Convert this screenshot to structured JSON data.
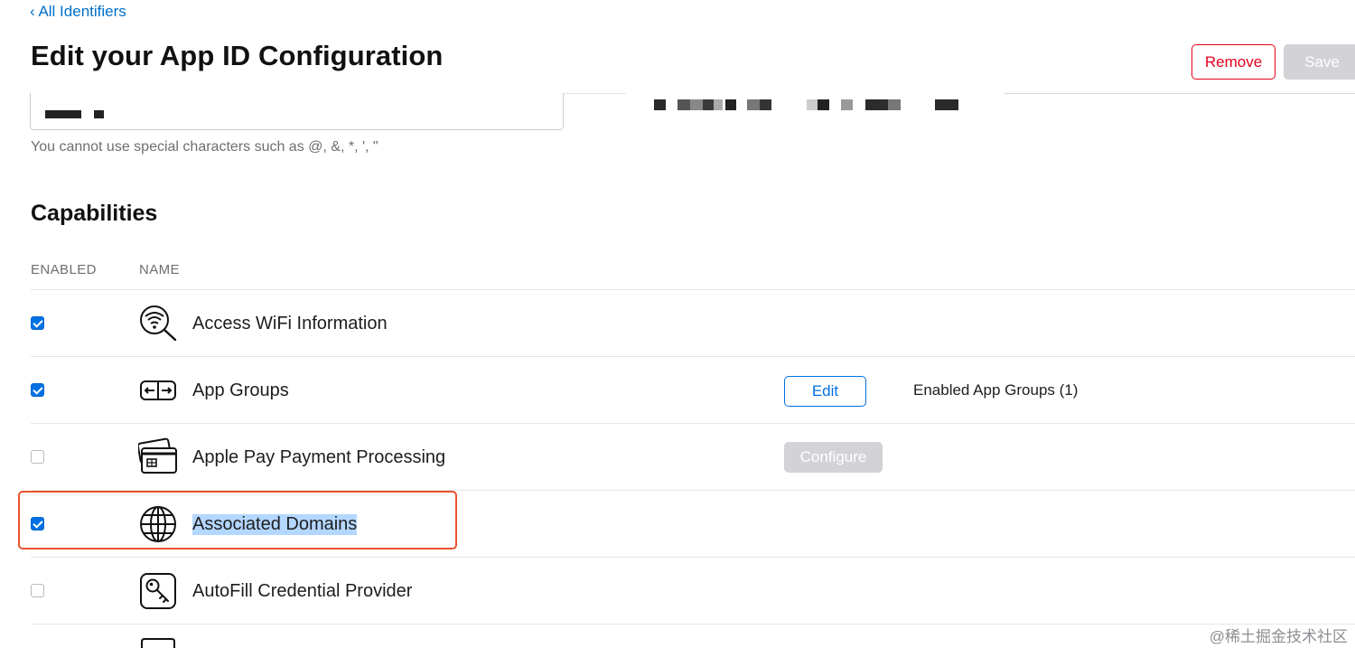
{
  "nav": {
    "back_label": "‹ All Identifiers"
  },
  "header": {
    "title": "Edit your App ID Configuration",
    "remove_label": "Remove",
    "save_label": "Save"
  },
  "description_field": {
    "helper_text": "You cannot use special characters such as @, &, *, ', \""
  },
  "capabilities": {
    "title": "Capabilities",
    "columns": {
      "enabled": "ENABLED",
      "name": "NAME"
    },
    "rows": [
      {
        "name": "Access WiFi Information",
        "enabled": true,
        "icon": "wifi-search-icon"
      },
      {
        "name": "App Groups",
        "enabled": true,
        "icon": "app-groups-icon",
        "action_label": "Edit",
        "extra": "Enabled App Groups (1)"
      },
      {
        "name": "Apple Pay Payment Processing",
        "enabled": false,
        "icon": "credit-card-icon",
        "action_label": "Configure"
      },
      {
        "name": "Associated Domains",
        "enabled": true,
        "icon": "globe-icon",
        "highlighted": true,
        "text_selected": true
      },
      {
        "name": "AutoFill Credential Provider",
        "enabled": false,
        "icon": "key-icon"
      }
    ]
  },
  "watermark": "@稀土掘金技术社区",
  "colors": {
    "link_blue": "#0070c9",
    "checkbox_blue": "#0071e3",
    "remove_red": "#e3001b",
    "highlight_orange": "#e8542d",
    "disabled_gray": "#d2d2d7"
  }
}
